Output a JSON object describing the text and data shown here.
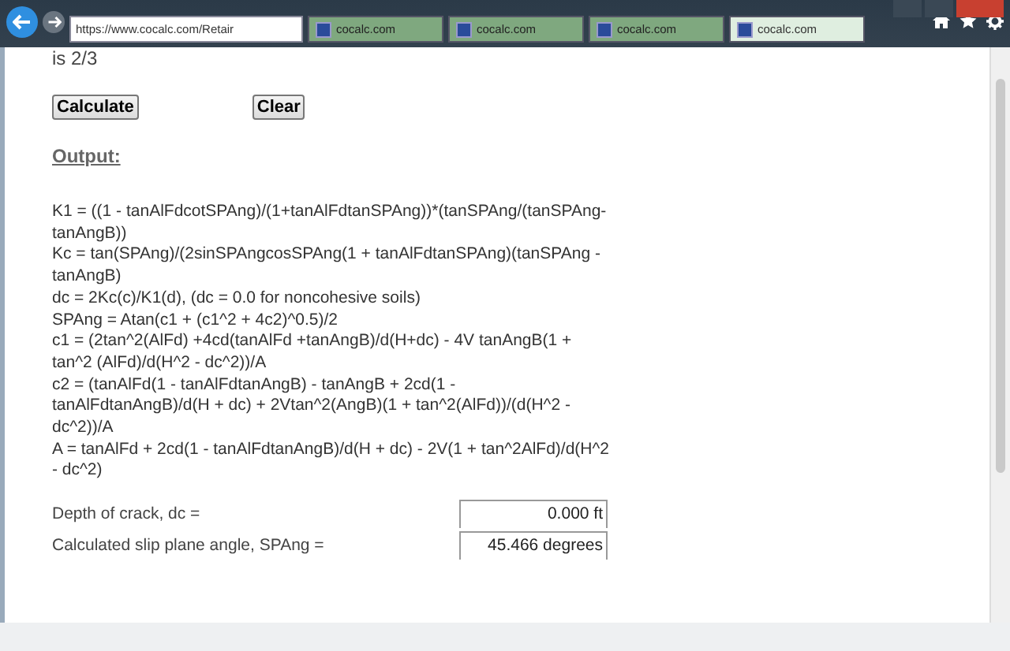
{
  "browser": {
    "address": "https://www.cocalc.com/Retair",
    "tabs": [
      {
        "label": "cocalc.com",
        "selected": false
      },
      {
        "label": "cocalc.com",
        "selected": false
      },
      {
        "label": "cocalc.com",
        "selected": false
      },
      {
        "label": "cocalc.com",
        "selected": true
      }
    ]
  },
  "page": {
    "intro_tail": "is 2/3",
    "buttons": [
      "Calculate",
      "Clear"
    ],
    "output_heading": "Output:",
    "formulas": [
      "K1 = ((1 - tanAlFdcotSPAng)/(1+tanAlFdtanSPAng))*(tanSPAng/(tanSPAng-tanAngB))",
      "Kc = tan(SPAng)/(2sinSPAngcosSPAng(1 + tanAlFdtanSPAng)(tanSPAng - tanAngB)",
      "dc = 2Kc(c)/K1(d), (dc = 0.0 for noncohesive soils)",
      "SPAng = Atan(c1 + (c1^2 + 4c2)^0.5)/2",
      "c1 = (2tan^2(AlFd) +4cd(tanAlFd +tanAngB)/d(H+dc) - 4V tanAngB(1 + tan^2 (AlFd)/d(H^2 - dc^2))/A",
      "c2 = (tanAlFd(1 - tanAlFdtanAngB) - tanAngB + 2cd(1 - tanAlFdtanAngB)/d(H + dc) + 2Vtan^2(AngB)(1 + tan^2(AlFd))/(d(H^2 - dc^2))/A",
      "A = tanAlFd + 2cd(1 - tanAlFdtanAngB)/d(H + dc) - 2V(1 + tan^2AlFd)/d(H^2 - dc^2)"
    ],
    "results": [
      {
        "label": "Depth of crack, dc =",
        "value": "0.000 ft"
      },
      {
        "label": "Calculated slip plane angle, SPAng =",
        "value": "45.466 degrees"
      }
    ]
  }
}
